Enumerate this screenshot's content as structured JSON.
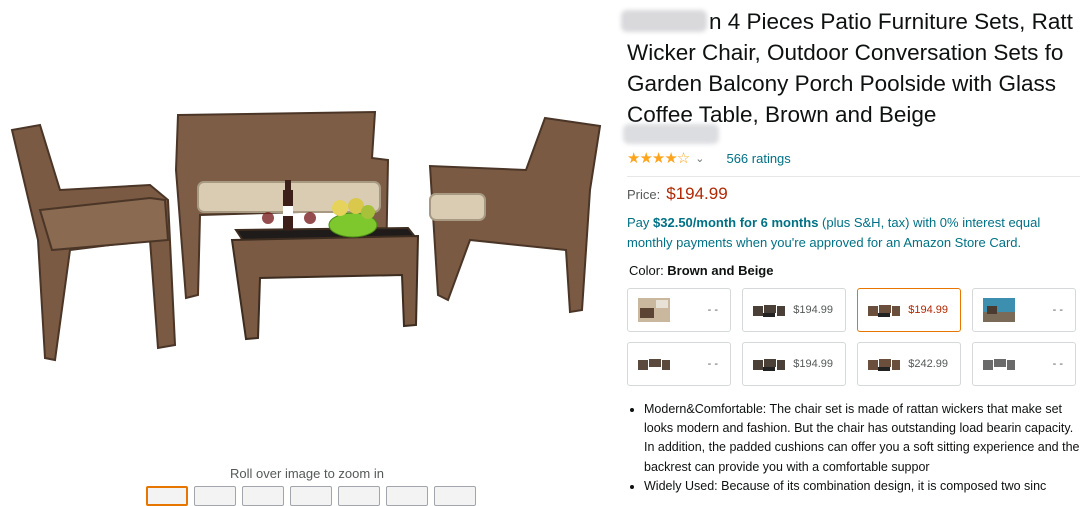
{
  "product": {
    "title_line1": "n 4 Pieces Patio Furniture Sets, Ratt",
    "title_line2": "Wicker Chair, Outdoor Conversation Sets fo",
    "title_line3": "Garden Balcony Porch Poolside with Glass",
    "title_line4": "Coffee Table, Brown and Beige",
    "rating_stars": 3.5,
    "rating_stars_text": "★★★★☆",
    "ratings_count": "566 ratings",
    "price_label": "Price:",
    "price_value": "$194.99",
    "finance_pay": "Pay ",
    "finance_amount": "$32.50/month for 6 months",
    "finance_rest_1": " (plus S&H, tax) with 0% interest equal",
    "finance_rest_2": "monthly payments when you're approved for an Amazon Store Card.",
    "color_label": "Color: ",
    "color_value": "Brown and Beige"
  },
  "gallery": {
    "zoom_hint": "Roll over image to zoom in"
  },
  "swatches": [
    {
      "price": "- -",
      "selected": false
    },
    {
      "price": "$194.99",
      "selected": false
    },
    {
      "price": "$194.99",
      "selected": true
    },
    {
      "price": "- -",
      "selected": false
    },
    {
      "price": "- -",
      "selected": false
    },
    {
      "price": "$194.99",
      "selected": false
    },
    {
      "price": "$242.99",
      "selected": false
    },
    {
      "price": "- -",
      "selected": false
    }
  ],
  "bullets": [
    "Modern&Comfortable: The chair set is made of rattan wickers that make set looks modern and fashion. But the chair has outstanding load bearin capacity. In addition, the padded cushions can offer you a soft sitting experience and the backrest can provide you with a comfortable suppor",
    "Widely Used: Because of its combination design, it is composed two sinc"
  ],
  "colors": {
    "link": "#007185",
    "price": "#b12704",
    "star": "#ffa41c",
    "selected_border": "#e77600"
  }
}
